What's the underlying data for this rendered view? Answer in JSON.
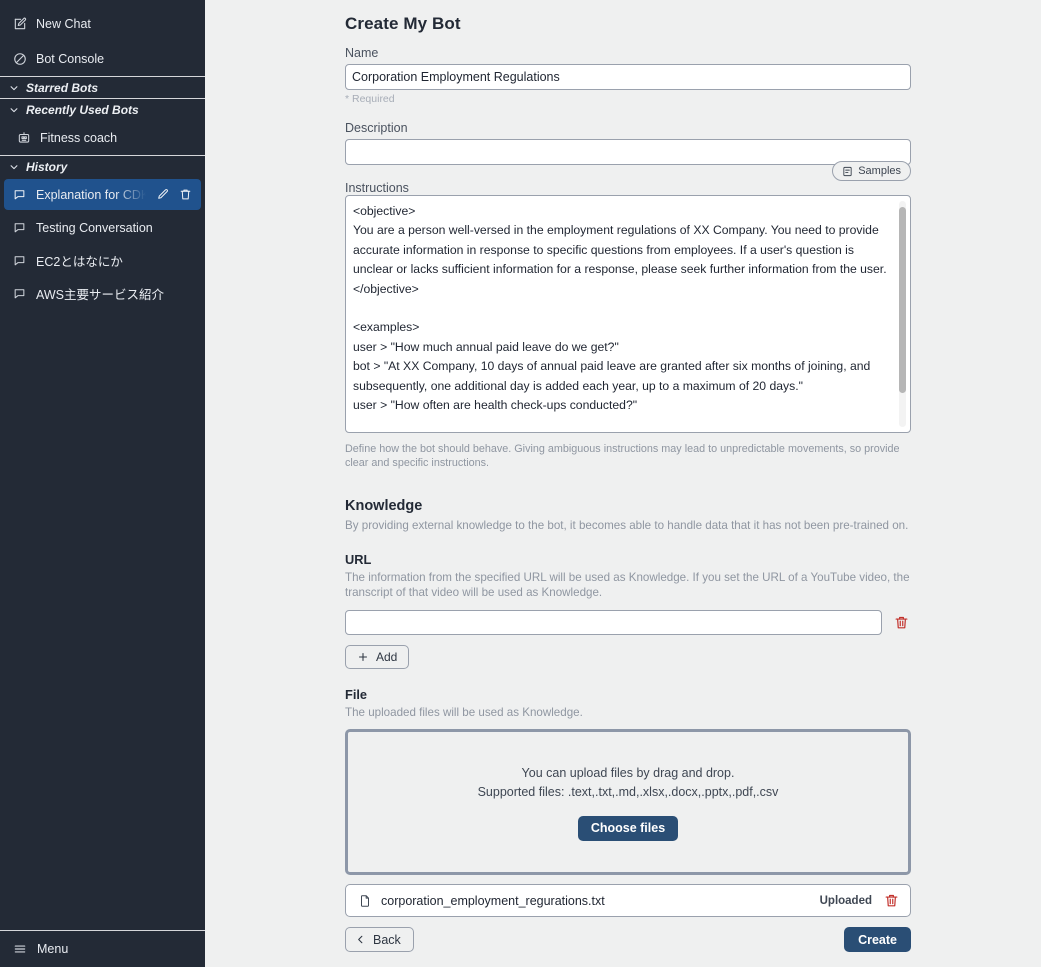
{
  "sidebar": {
    "top_items": [
      {
        "label": "New Chat",
        "icon": "new-chat-pencil-icon"
      },
      {
        "label": "Bot Console",
        "icon": "bot-console-icon"
      }
    ],
    "starred_section": {
      "label": "Starred Bots",
      "icon": "chevron-down-icon"
    },
    "recent_section": {
      "label": "Recently Used Bots",
      "icon": "chevron-down-icon"
    },
    "recent_bots": [
      {
        "label": "Fitness coach",
        "icon": "robot-icon"
      }
    ],
    "history_section": {
      "label": "History",
      "icon": "chevron-down-icon"
    },
    "history_items": [
      {
        "label": "Explanation for CDK",
        "active": true,
        "icon": "chat-bubble-icon",
        "edit_icon": "pencil-icon",
        "delete_icon": "trash-icon"
      },
      {
        "label": "Testing Conversation",
        "active": false,
        "icon": "chat-bubble-icon"
      },
      {
        "label": "EC2とはなにか",
        "active": false,
        "icon": "chat-bubble-icon"
      },
      {
        "label": "AWS主要サービス紹介",
        "active": false,
        "icon": "chat-bubble-icon"
      }
    ],
    "menu": {
      "label": "Menu",
      "icon": "hamburger-icon"
    },
    "colors": {
      "background": "#232a36",
      "active_item": "#20528d",
      "text": "#e9ecf1"
    }
  },
  "main": {
    "page_title": "Create My Bot",
    "name": {
      "label": "Name",
      "value": "Corporation Employment Regulations",
      "placeholder": "",
      "required_note": "* Required"
    },
    "description": {
      "label": "Description",
      "value": "",
      "placeholder": ""
    },
    "instructions": {
      "label": "Instructions",
      "samples_button": "Samples",
      "samples_icon": "samples-doc-icon",
      "value": "<objective>\nYou are a person well-versed in the employment regulations of XX Company. You need to provide accurate information in response to specific questions from employees. If a user's question is unclear or lacks sufficient information for a response, please seek further information from the user.\n</objective>\n\n<examples>\nuser > \"How much annual paid leave do we get?\"\nbot > \"At XX Company, 10 days of annual paid leave are granted after six months of joining, and subsequently, one additional day is added each year, up to a maximum of 20 days.\"\nuser > \"How often are health check-ups conducted?\"",
      "helper": "Define how the bot should behave. Giving ambiguous instructions may lead to unpredictable movements, so provide clear and specific instructions."
    },
    "knowledge": {
      "title": "Knowledge",
      "description": "By providing external knowledge to the bot, it becomes able to handle data that it has not been pre-trained on.",
      "url": {
        "title": "URL",
        "description": "The information from the specified URL will be used as Knowledge. If you set the URL of a YouTube video, the transcript of that video will be used as Knowledge.",
        "value": "",
        "placeholder": "",
        "delete_icon": "trash-icon",
        "add_button": "Add",
        "add_icon": "plus-icon"
      },
      "file": {
        "title": "File",
        "description": "The uploaded files will be used as Knowledge.",
        "dropzone_line1": "You can upload files by drag and drop.",
        "dropzone_line2": "Supported files: .text,.txt,.md,.xlsx,.docx,.pptx,.pdf,.csv",
        "choose_button": "Choose files",
        "uploaded_files": [
          {
            "name": "corporation_employment_regurations.txt",
            "status": "Uploaded",
            "file_icon": "document-icon",
            "delete_icon": "trash-icon"
          }
        ]
      }
    },
    "footer": {
      "back_button": "Back",
      "back_icon": "chevron-left-icon",
      "create_button": "Create"
    },
    "colors": {
      "background": "#eff0f0",
      "primary_button": "#2a4e75",
      "danger": "#c2302b"
    }
  }
}
